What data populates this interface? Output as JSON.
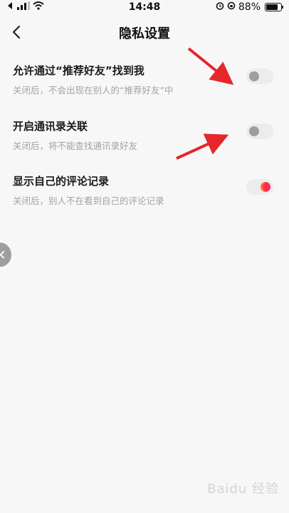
{
  "status_bar": {
    "time": "14:48",
    "battery_percent": "88%",
    "battery_level": 0.88
  },
  "nav": {
    "title": "隐私设置"
  },
  "settings": [
    {
      "title": "允许通过“推荐好友”找到我",
      "description": "关闭后，不会出现在别人的“推荐好友”中",
      "enabled": false
    },
    {
      "title": "开启通讯录关联",
      "description": "关闭后，将不能查找通讯录好友",
      "enabled": false
    },
    {
      "title": "显示自己的评论记录",
      "description": "关闭后，别人不在看到自己的评论记录",
      "enabled": true
    }
  ],
  "colors": {
    "toggle_on": "#fe2c55",
    "toggle_off": "#ececec",
    "annotation_arrow": "#e5262b"
  },
  "watermark": {
    "text": "Baidu 经验"
  }
}
